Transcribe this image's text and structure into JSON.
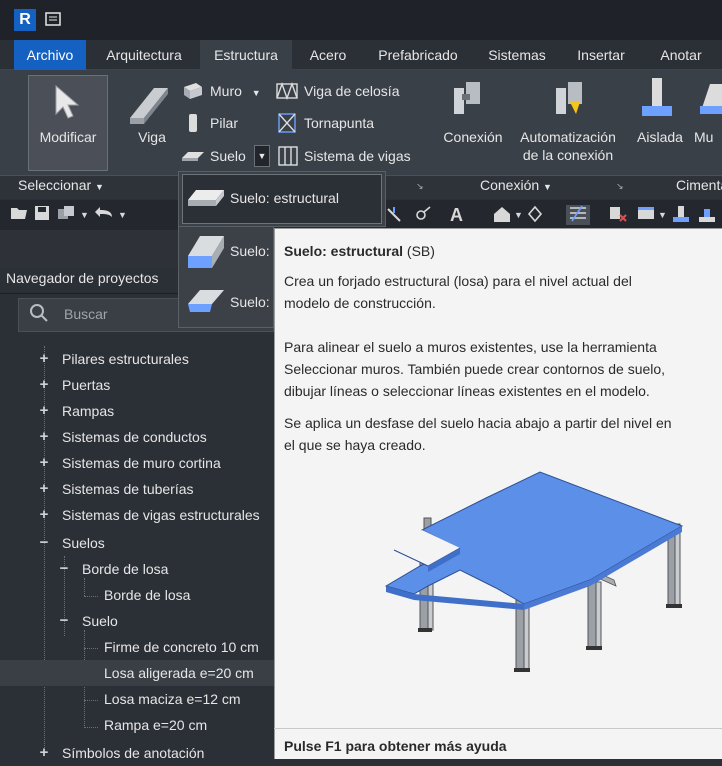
{
  "app": {
    "logo_letter": "R"
  },
  "menu": {
    "tabs": [
      "Archivo",
      "Arquitectura",
      "Estructura",
      "Acero",
      "Prefabricado",
      "Sistemas",
      "Insertar",
      "Anotar"
    ]
  },
  "ribbon": {
    "modify_label": "Modificar",
    "viga_label": "Viga",
    "muro_label": "Muro",
    "pilar_label": "Pilar",
    "suelo_label": "Suelo",
    "viga_celosia_label": "Viga de celosía",
    "tornapunta_label": "Tornapunta",
    "sistema_vigas_label": "Sistema de vigas",
    "conexion_label": "Conexión",
    "automatizacion_label_1": "Automatización",
    "automatizacion_label_2": "de la conexión",
    "aislada_label": "Aislada",
    "mu_label": "Mu",
    "panel_seleccionar": "Seleccionar",
    "panel_conexion": "Conexión",
    "panel_cimentacion": "Cimentación"
  },
  "dropdown": {
    "item1": "Suelo: estructural",
    "item2": "Suelo:",
    "item3": "Suelo:"
  },
  "browser": {
    "title": "Navegador de proyectos",
    "search_placeholder": "Buscar",
    "items": [
      {
        "sign": "+",
        "label": "Pilares estructurales"
      },
      {
        "sign": "+",
        "label": "Puertas"
      },
      {
        "sign": "+",
        "label": "Rampas"
      },
      {
        "sign": "+",
        "label": "Sistemas de conductos"
      },
      {
        "sign": "+",
        "label": "Sistemas de muro cortina"
      },
      {
        "sign": "+",
        "label": "Sistemas de tuberías"
      },
      {
        "sign": "+",
        "label": "Sistemas de vigas estructurales"
      },
      {
        "sign": "−",
        "label": "Suelos"
      },
      {
        "sign": "−",
        "label": "Borde de losa"
      },
      {
        "sign": "",
        "label": "Borde de losa"
      },
      {
        "sign": "−",
        "label": "Suelo"
      },
      {
        "sign": "",
        "label": "Firme de concreto 10 cm"
      },
      {
        "sign": "",
        "label": "Losa aligerada e=20 cm"
      },
      {
        "sign": "",
        "label": "Losa maciza e=12 cm"
      },
      {
        "sign": "",
        "label": "Rampa e=20 cm"
      },
      {
        "sign": "+",
        "label": "Símbolos de anotación"
      }
    ]
  },
  "tooltip": {
    "title": "Suelo: estructural",
    "shortcut": "(SB)",
    "line1": "Crea un forjado estructural (losa) para el nivel actual del",
    "line2": "modelo de construcción.",
    "p2_1": "Para alinear el suelo a muros existentes, use la herramienta",
    "p2_2": "Seleccionar muros. También puede crear contornos de suelo,",
    "p2_3": "dibujar líneas o seleccionar líneas existentes en el modelo.",
    "p3_1": "Se aplica un desfase del suelo hacia abajo a partir del nivel en",
    "p3_2": "el que se haya creado.",
    "footer": "Pulse F1 para obtener más ayuda"
  },
  "colors": {
    "accent": "#1561c1",
    "slab": "#5b8fe8"
  }
}
